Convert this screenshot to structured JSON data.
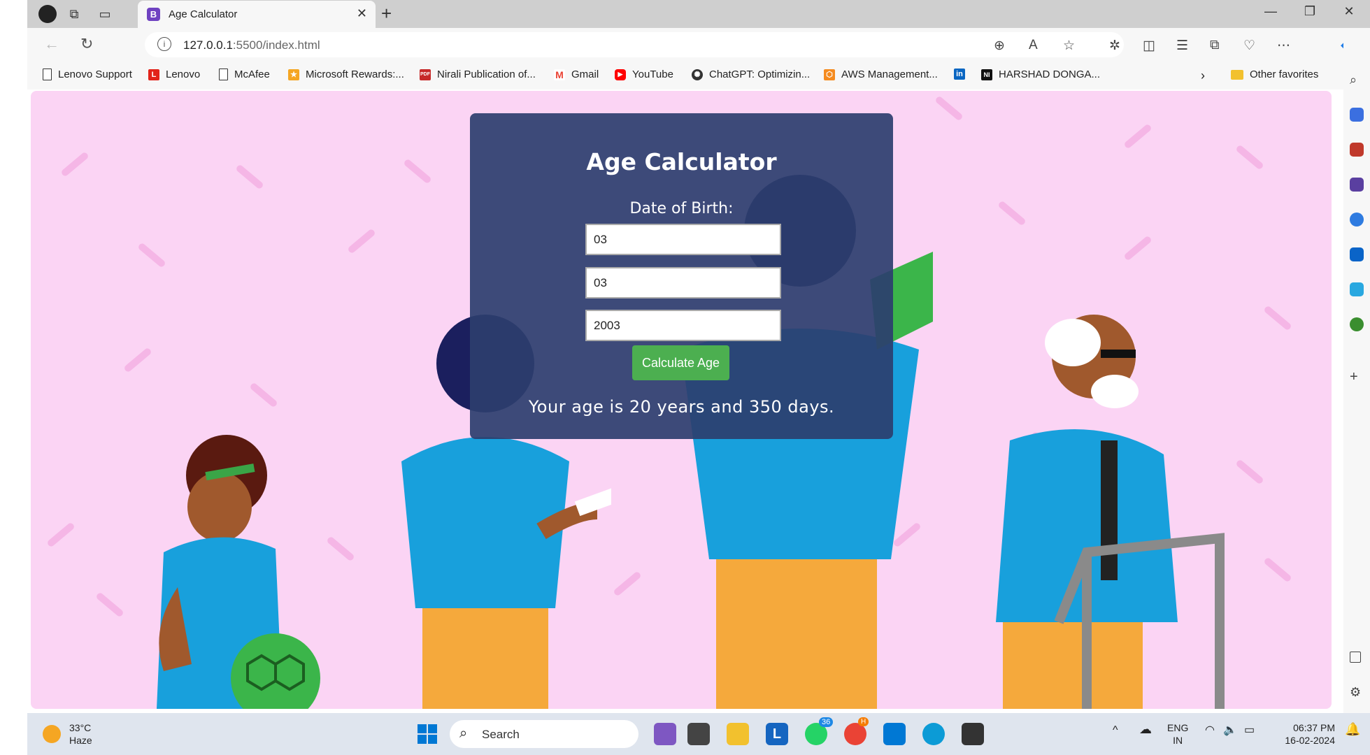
{
  "browser": {
    "tab_title": "Age Calculator",
    "tab_favicon_letter": "B",
    "url_host": "127.0.0.1",
    "url_rest": ":5500/index.html",
    "bookmarks": [
      {
        "label": "Lenovo Support",
        "icon": "document-icon"
      },
      {
        "label": "Lenovo",
        "icon": "lenovo-icon"
      },
      {
        "label": "McAfee",
        "icon": "document-icon"
      },
      {
        "label": "Microsoft Rewards:...",
        "icon": "rewards-icon"
      },
      {
        "label": "Nirali Publication of...",
        "icon": "pdf-icon"
      },
      {
        "label": "Gmail",
        "icon": "gmail-icon"
      },
      {
        "label": "YouTube",
        "icon": "youtube-icon"
      },
      {
        "label": "ChatGPT: Optimizin...",
        "icon": "chatgpt-icon"
      },
      {
        "label": "AWS Management...",
        "icon": "aws-icon"
      },
      {
        "label": "",
        "icon": "linkedin-icon"
      },
      {
        "label": "HARSHAD DONGA...",
        "icon": "ni-icon"
      }
    ],
    "other_favorites": "Other favorites"
  },
  "app": {
    "title": "Age Calculator",
    "dob_label": "Date of Birth:",
    "day_value": "03",
    "month_value": "03",
    "year_value": "2003",
    "button_label": "Calculate Age",
    "result": "Your age is 20 years and 350 days."
  },
  "taskbar": {
    "temperature": "33°C",
    "weather": "Haze",
    "search_label": "Search",
    "whatsapp_badge": "36",
    "chrome_badge": "H",
    "lang": "ENG",
    "region": "IN",
    "time": "06:37 PM",
    "date": "16-02-2024"
  },
  "colors": {
    "page_bg": "#fbd4f4",
    "card_bg": "#2c3e6e",
    "button": "#4caf50"
  }
}
